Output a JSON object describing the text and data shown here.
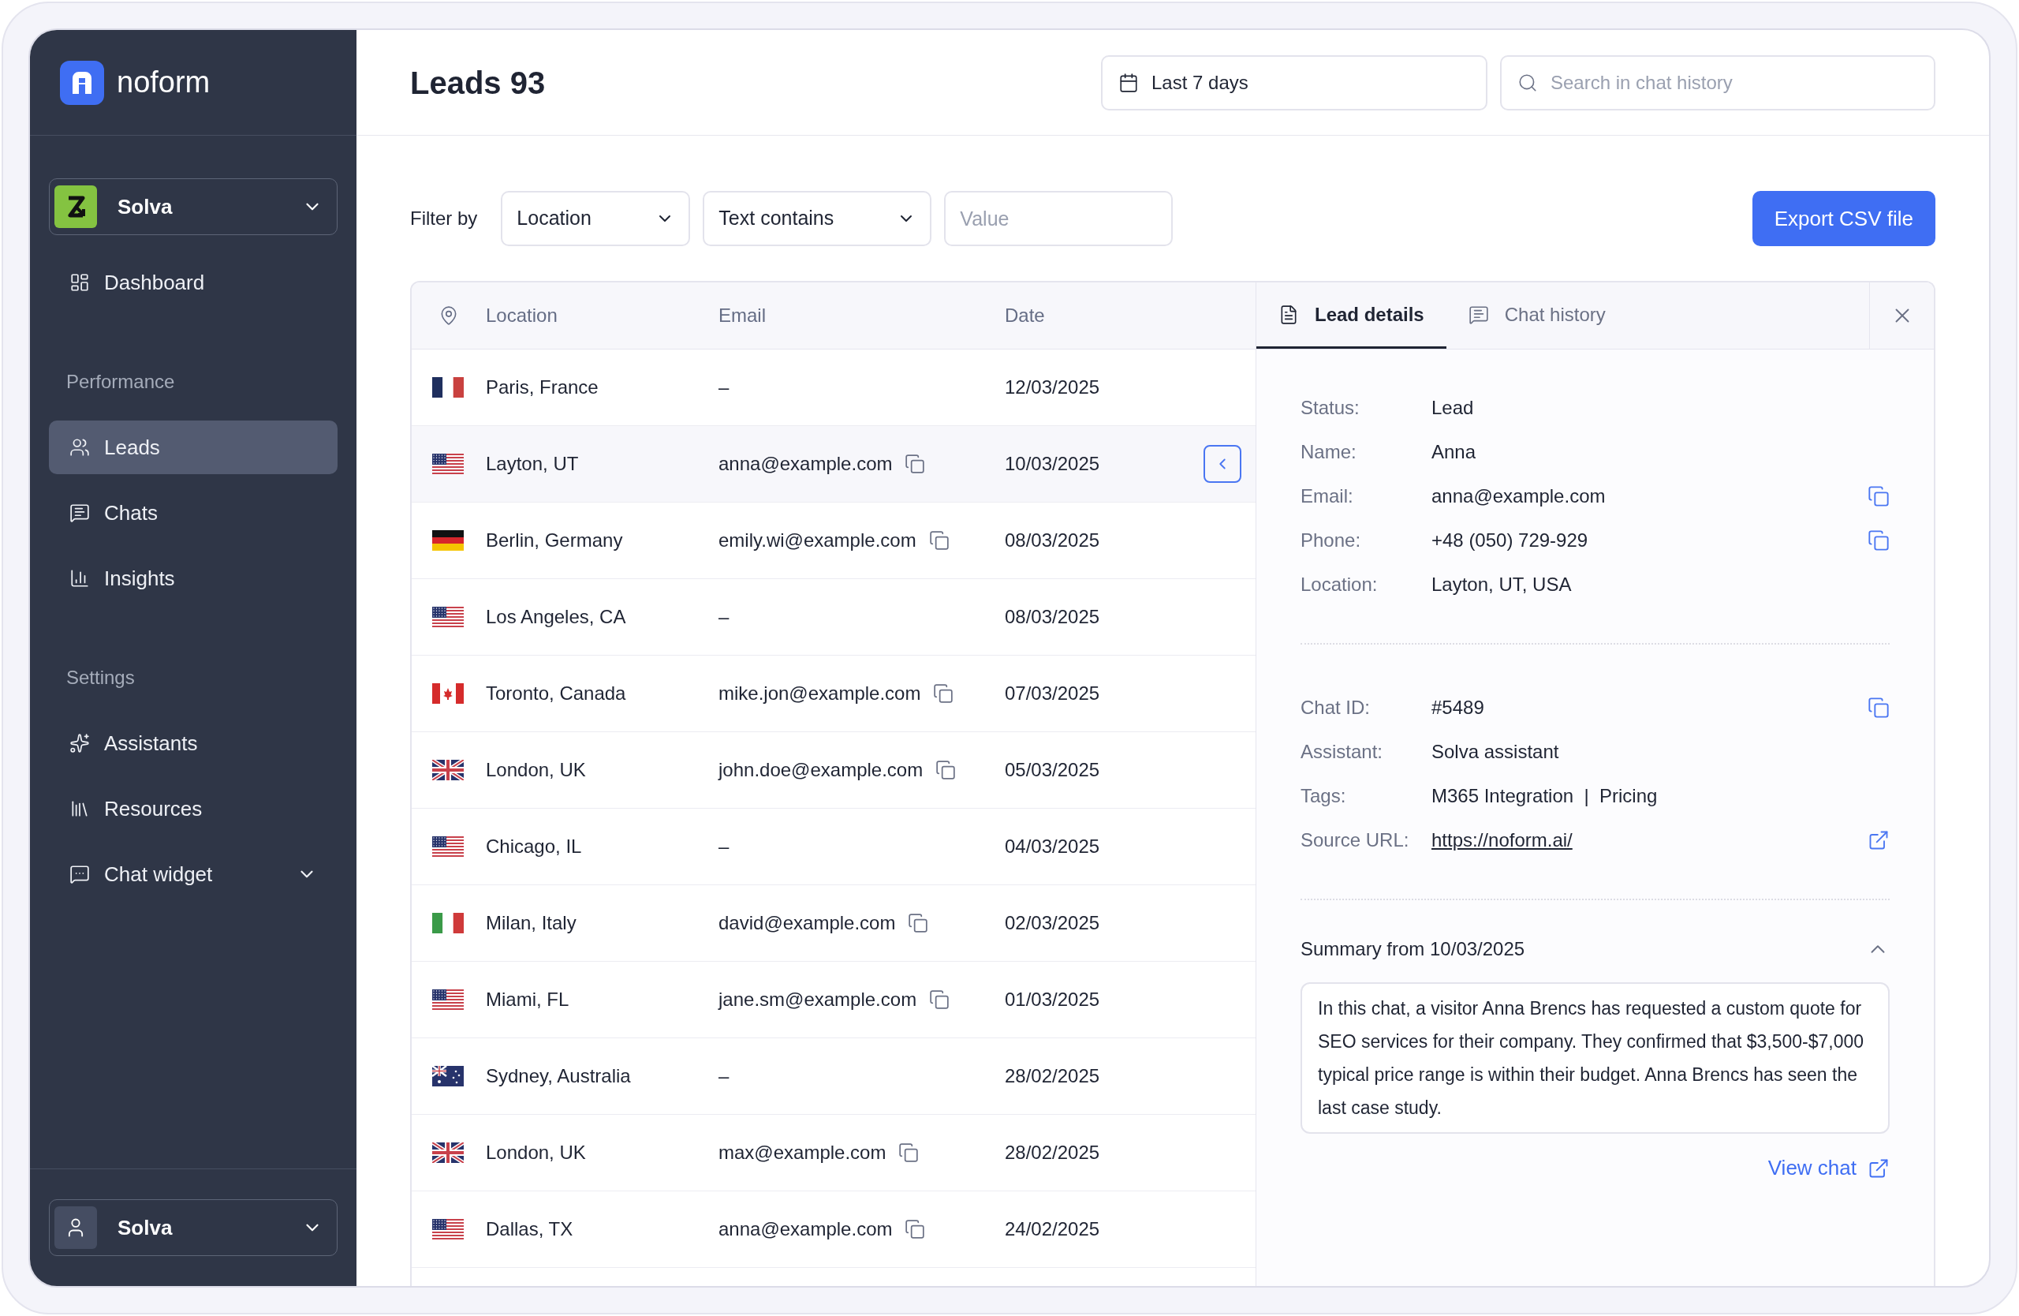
{
  "brand": "noform",
  "sidebar": {
    "workspace": "Solva",
    "items": [
      {
        "label": "Dashboard",
        "kind": "item",
        "selected": false
      },
      {
        "label": "Performance",
        "kind": "section"
      },
      {
        "label": "Leads",
        "kind": "item",
        "selected": true
      },
      {
        "label": "Chats",
        "kind": "item",
        "selected": false
      },
      {
        "label": "Insights",
        "kind": "item",
        "selected": false
      },
      {
        "label": "Settings",
        "kind": "section"
      },
      {
        "label": "Assistants",
        "kind": "item",
        "selected": false
      },
      {
        "label": "Resources",
        "kind": "item",
        "selected": false
      },
      {
        "label": "Chat widget",
        "kind": "group",
        "selected": false
      }
    ],
    "user": "Solva"
  },
  "header": {
    "title": "Leads 93",
    "date_range": "Last 7 days",
    "search": {
      "placeholder": "Search in chat history"
    }
  },
  "filter": {
    "label": "Filter by",
    "field": "Location",
    "operator": "Text contains",
    "value": {
      "placeholder": "Value"
    },
    "export_button": "Export CSV file"
  },
  "table": {
    "columns": [
      "Location",
      "Email",
      "Date"
    ],
    "rows": [
      {
        "kind": "fr",
        "location": "Paris, France",
        "email": "–",
        "has_email": false,
        "date": "12/03/2025",
        "selected": false
      },
      {
        "kind": "us",
        "location": "Layton, UT",
        "email": "anna@example.com",
        "has_email": true,
        "date": "10/03/2025",
        "selected": true
      },
      {
        "kind": "de",
        "location": "Berlin, Germany",
        "email": "emily.wi@example.com",
        "has_email": true,
        "date": "08/03/2025",
        "selected": false
      },
      {
        "kind": "us",
        "location": "Los Angeles, CA",
        "email": "–",
        "has_email": false,
        "date": "08/03/2025",
        "selected": false
      },
      {
        "kind": "ca",
        "location": "Toronto, Canada",
        "email": "mike.jon@example.com",
        "has_email": true,
        "date": "07/03/2025",
        "selected": false
      },
      {
        "kind": "gb",
        "location": "London, UK",
        "email": "john.doe@example.com",
        "has_email": true,
        "date": "05/03/2025",
        "selected": false
      },
      {
        "kind": "us",
        "location": "Chicago, IL",
        "email": "–",
        "has_email": false,
        "date": "04/03/2025",
        "selected": false
      },
      {
        "kind": "it",
        "location": "Milan, Italy",
        "email": "david@example.com",
        "has_email": true,
        "date": "02/03/2025",
        "selected": false
      },
      {
        "kind": "us",
        "location": "Miami, FL",
        "email": "jane.sm@example.com",
        "has_email": true,
        "date": "01/03/2025",
        "selected": false
      },
      {
        "kind": "au",
        "location": "Sydney, Australia",
        "email": "–",
        "has_email": false,
        "date": "28/02/2025",
        "selected": false
      },
      {
        "kind": "gb",
        "location": "London, UK",
        "email": "max@example.com",
        "has_email": true,
        "date": "28/02/2025",
        "selected": false
      },
      {
        "kind": "us",
        "location": "Dallas, TX",
        "email": "anna@example.com",
        "has_email": true,
        "date": "24/02/2025",
        "selected": false
      }
    ]
  },
  "details": {
    "tabs": [
      {
        "label": "Lead details",
        "selected": true
      },
      {
        "label": "Chat history",
        "selected": false
      }
    ],
    "groups": [
      [
        {
          "label": "Status:",
          "value": "Lead",
          "kind": "plain"
        },
        {
          "label": "Name:",
          "value": "Anna",
          "kind": "plain"
        },
        {
          "label": "Email:",
          "value": "anna@example.com",
          "kind": "copy"
        },
        {
          "label": "Phone:",
          "value": "+48 (050) 729-929",
          "kind": "copy"
        },
        {
          "label": "Location:",
          "value": "Layton, UT, USA",
          "kind": "plain"
        }
      ],
      [
        {
          "label": "Chat ID:",
          "value": "#5489",
          "kind": "copy"
        },
        {
          "label": "Assistant:",
          "value": "Solva assistant",
          "kind": "plain"
        },
        {
          "label": "Tags:",
          "value": "M365 Integration  |  Pricing",
          "kind": "plain"
        },
        {
          "label": "Source URL:",
          "value": "https://noform.ai/",
          "kind": "link"
        }
      ]
    ],
    "summary": {
      "title": "Summary from 10/03/2025",
      "expanded": true,
      "text": "In this chat, a visitor Anna Brencs has requested a custom quote for SEO services for their company. They confirmed that $3,500-$7,000 typical price range is within their budget. Anna Brencs has seen the last case study."
    },
    "view_chat": "View chat"
  }
}
